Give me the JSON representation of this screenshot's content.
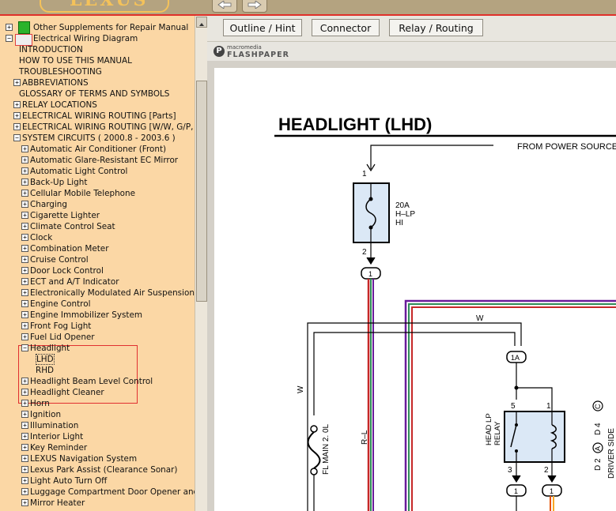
{
  "header": {
    "logo_text": "LEXUS",
    "back_icon": "arrow-left-icon",
    "forward_icon": "arrow-right-icon",
    "accent_color": "#e0302a"
  },
  "tree": {
    "items": [
      {
        "label": "Other Supplements for Repair Manual",
        "exp": "+"
      },
      {
        "label": "Electrical Wiring Diagram",
        "exp": "−"
      },
      {
        "label": "INTRODUCTION",
        "exp": ""
      },
      {
        "label": "HOW TO USE THIS MANUAL",
        "exp": ""
      },
      {
        "label": "TROUBLESHOOTING",
        "exp": ""
      },
      {
        "label": "ABBREVIATIONS",
        "exp": "+"
      },
      {
        "label": "GLOSSARY OF TERMS AND SYMBOLS",
        "exp": ""
      },
      {
        "label": "RELAY LOCATIONS",
        "exp": "+"
      },
      {
        "label": "ELECTRICAL WIRING ROUTING [Parts]",
        "exp": "+"
      },
      {
        "label": "ELECTRICAL WIRING ROUTING [W/W, G/P, S/",
        "exp": "+"
      },
      {
        "label": "SYSTEM CIRCUITS ( 2000.8 - 2003.6 )",
        "exp": "−"
      },
      {
        "label": "Automatic Air Conditioner (Front)",
        "exp": "+"
      },
      {
        "label": "Automatic Glare-Resistant EC Mirror",
        "exp": "+"
      },
      {
        "label": "Automatic Light Control",
        "exp": "+"
      },
      {
        "label": "Back-Up Light",
        "exp": "+"
      },
      {
        "label": "Cellular Mobile Telephone",
        "exp": "+"
      },
      {
        "label": "Charging",
        "exp": "+"
      },
      {
        "label": "Cigarette Lighter",
        "exp": "+"
      },
      {
        "label": "Climate Control Seat",
        "exp": "+"
      },
      {
        "label": "Clock",
        "exp": "+"
      },
      {
        "label": "Combination Meter",
        "exp": "+"
      },
      {
        "label": "Cruise Control",
        "exp": "+"
      },
      {
        "label": "Door Lock Control",
        "exp": "+"
      },
      {
        "label": "ECT and A/T Indicator",
        "exp": "+"
      },
      {
        "label": "Electronically Modulated Air Suspension",
        "exp": "+"
      },
      {
        "label": "Engine Control",
        "exp": "+"
      },
      {
        "label": "Engine Immobilizer System",
        "exp": "+"
      },
      {
        "label": "Front Fog Light",
        "exp": "+"
      },
      {
        "label": "Fuel Lid Opener",
        "exp": "+"
      },
      {
        "label": "Headlight",
        "exp": "−"
      },
      {
        "label": "LHD",
        "exp": ""
      },
      {
        "label": "RHD",
        "exp": ""
      },
      {
        "label": "Headlight Beam Level Control",
        "exp": "+"
      },
      {
        "label": "Headlight Cleaner",
        "exp": "+"
      },
      {
        "label": "Horn",
        "exp": "+"
      },
      {
        "label": "Ignition",
        "exp": "+"
      },
      {
        "label": "Illumination",
        "exp": "+"
      },
      {
        "label": "Interior Light",
        "exp": "+"
      },
      {
        "label": "Key Reminder",
        "exp": "+"
      },
      {
        "label": "LEXUS Navigation System",
        "exp": "+"
      },
      {
        "label": "Lexus Park Assist (Clearance Sonar)",
        "exp": "+"
      },
      {
        "label": "Light Auto Turn Off",
        "exp": "+"
      },
      {
        "label": "Luggage Compartment Door Opener and Cl",
        "exp": "+"
      },
      {
        "label": "Mirror Heater",
        "exp": "+"
      }
    ]
  },
  "tabs": {
    "outline": "Outline / Hint",
    "connector": "Connector",
    "relay": "Relay / Routing"
  },
  "viewer": {
    "brand_top": "macromedia",
    "brand_main": "FLASHPAPER"
  },
  "diagram": {
    "title": "HEADLIGHT (LHD)",
    "from_power": "FROM POWER SOURCE",
    "fuse_amp": "20A",
    "fuse_name": "H–LP",
    "fuse_hi": "HI",
    "pin_1": "1",
    "pin_2": "2",
    "conn_1": "1",
    "wire_w_top": "W",
    "wire_w_left": "W",
    "conn_1a": "1A",
    "fl_main": "FL MAIN 2. 0L",
    "wire_rl": "R–L",
    "relay_pin5": "5",
    "relay_pin1": "1",
    "relay_pin3": "3",
    "relay_pin2": "2",
    "relay_label_1": "HEAD LP",
    "relay_label_2": "RELAY",
    "conn_b1": "1",
    "conn_b2": "1",
    "right_d2": "D 2",
    "right_a": "A",
    "right_d4": "D 4",
    "right_c": "C",
    "right_driver": "DRIVER SIDE"
  }
}
